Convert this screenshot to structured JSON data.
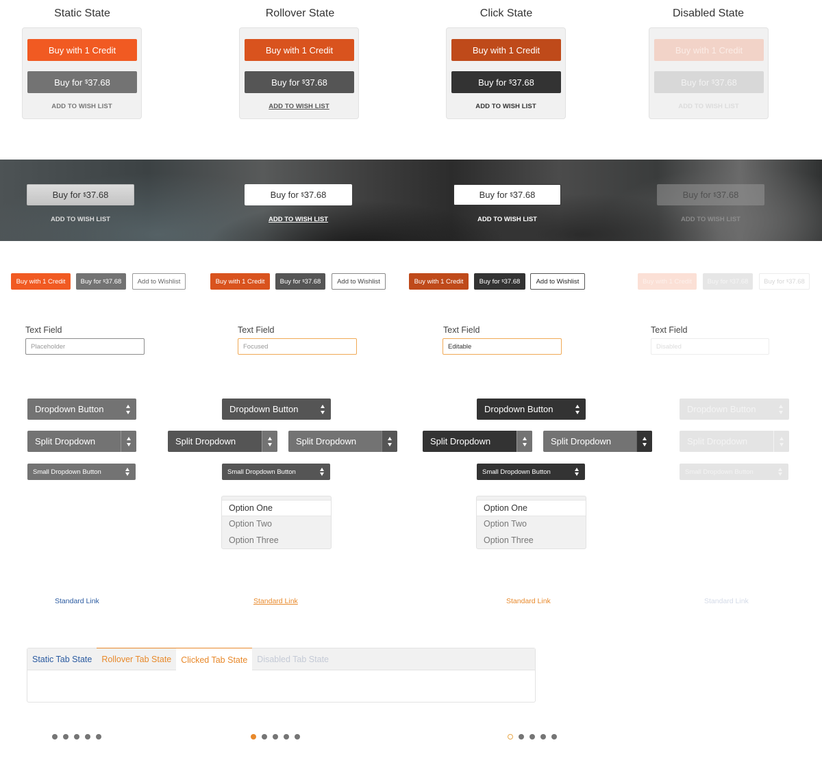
{
  "columns": [
    {
      "title": "Static State"
    },
    {
      "title": "Rollover State"
    },
    {
      "title": "Click State"
    },
    {
      "title": "Disabled State"
    }
  ],
  "cards": {
    "credit_label": "Buy with 1 Credit",
    "price_prefix": "Buy for ",
    "currency_symbol": "$",
    "price": "37.68",
    "wish_label": "ADD TO WISH LIST"
  },
  "band": {
    "price_prefix": "Buy for ",
    "currency_symbol": "$",
    "price": "37.68",
    "wish_label": "ADD TO WISH LIST"
  },
  "small_buttons": {
    "credit_label": "Buy with 1 Credit",
    "price_prefix": "Buy for ",
    "currency_symbol": "$",
    "price": "37.68",
    "wishlist_label": "Add to Wishlist"
  },
  "text_fields": [
    {
      "label": "Text Field",
      "value": "",
      "placeholder": "Placeholder"
    },
    {
      "label": "Text Field",
      "value": "",
      "placeholder": "Focused"
    },
    {
      "label": "Text Field",
      "value": "Editable",
      "placeholder": ""
    },
    {
      "label": "Text Field",
      "value": "",
      "placeholder": "Disabled"
    }
  ],
  "dropdowns": {
    "dropdown_label": "Dropdown Button",
    "split_label": "Split Dropdown",
    "small_label": "Small Dropdown Button"
  },
  "menus": {
    "options": [
      "Option One",
      "Option Two",
      "Option Three"
    ],
    "selected": "Option One"
  },
  "links": {
    "label": "Standard Link"
  },
  "tabs": [
    {
      "label": "Static Tab State",
      "state": "static"
    },
    {
      "label": "Rollover Tab State",
      "state": "rollover"
    },
    {
      "label": "Clicked Tab State",
      "state": "clicked"
    },
    {
      "label": "Disabled Tab State",
      "state": "disabled"
    }
  ],
  "pagination": [
    {
      "count": 5,
      "active_index": null
    },
    {
      "count": 5,
      "active_index": 0,
      "active_style": "filled"
    },
    {
      "count": 5,
      "active_index": 0,
      "active_style": "ring"
    }
  ],
  "colors": {
    "orange_static": "#f15a22",
    "orange_rollover": "#d9531e",
    "orange_click": "#bf4a1a",
    "orange_disabled": "#f2d3c8",
    "gray_static": "#737373",
    "gray_rollover": "#555555",
    "gray_click": "#333333",
    "gray_disabled": "#d8d8d8",
    "focus_border": "#f0a955",
    "link_blue": "#2a5aa0",
    "link_orange": "#e8892b",
    "link_disabled": "#d4dbe8"
  }
}
